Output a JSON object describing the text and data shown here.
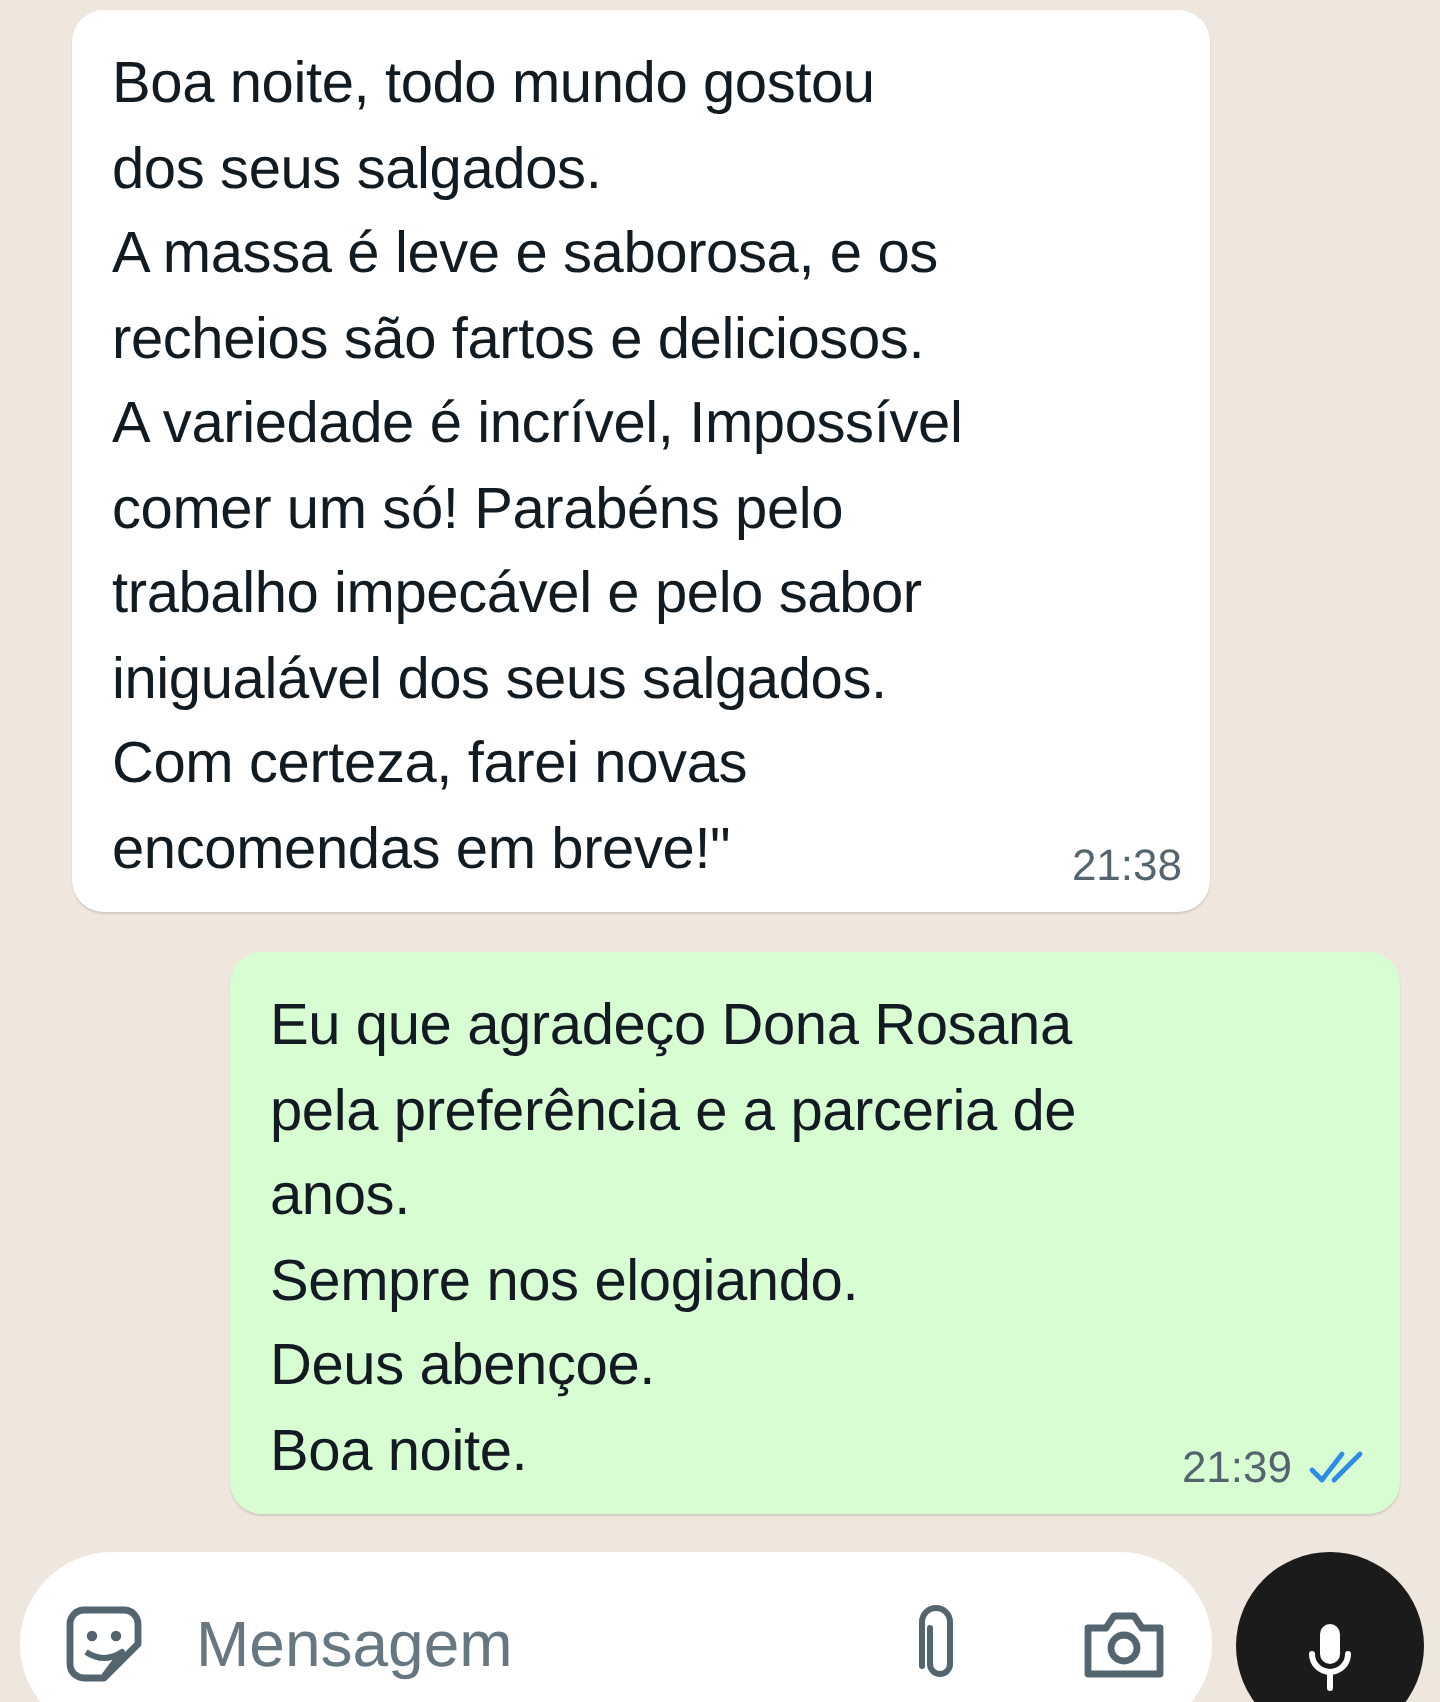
{
  "messages": [
    {
      "kind": "received",
      "text": "Boa noite, todo mundo gostou\ndos seus salgados.\nA massa é leve e saborosa, e os\nrecheios são fartos e deliciosos.\nA variedade é incrível, Impossível\ncomer um só! Parabéns pelo\ntrabalho impecável e pelo sabor\ninigualável dos seus salgados.\nCom certeza, farei novas\nencomendas em breve!\"",
      "time": "21:38"
    },
    {
      "kind": "sent",
      "text": "Eu que agradeço Dona Rosana\npela preferência e a parceria de\nanos.\nSempre nos elogiando.\nDeus abençoe.\nBoa noite.",
      "time": "21:39",
      "read": true
    }
  ],
  "composer": {
    "placeholder": "Mensagem"
  }
}
